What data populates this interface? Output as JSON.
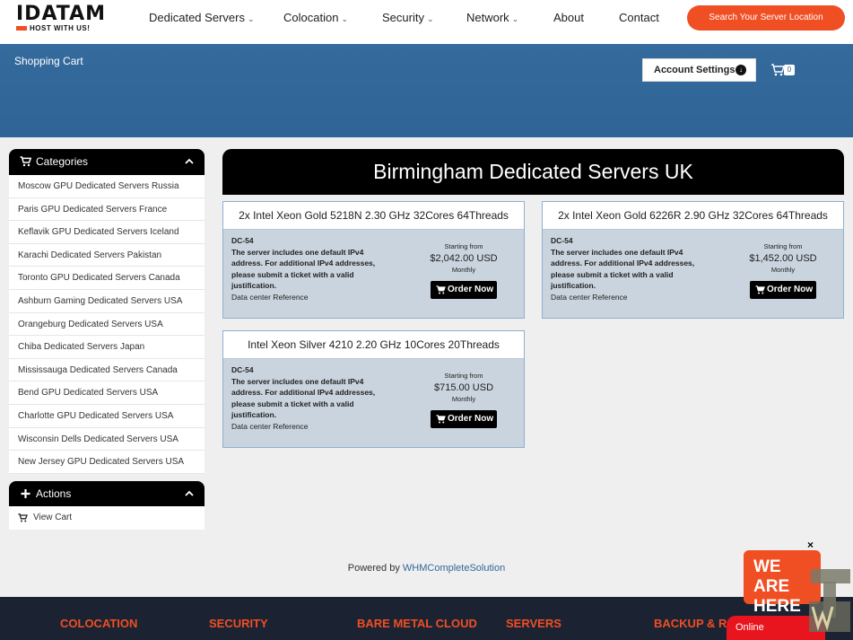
{
  "brand": {
    "name": "IDATAM",
    "tagline": "HOST WITH US!",
    "accent": "#f04e23"
  },
  "nav": {
    "items": [
      {
        "label": "Dedicated Servers",
        "dropdown": true
      },
      {
        "label": "Colocation",
        "dropdown": true
      },
      {
        "label": "Security",
        "dropdown": true
      },
      {
        "label": "Network",
        "dropdown": true
      },
      {
        "label": "About",
        "dropdown": false
      },
      {
        "label": "Contact",
        "dropdown": false
      }
    ],
    "search_button": "Search Your Server Location"
  },
  "header": {
    "title": "Shopping Cart",
    "account_button": "Account Settings",
    "cart_count": "0",
    "band_color": "#336699"
  },
  "sidebar": {
    "categories_title": "Categories",
    "categories": [
      "Moscow GPU Dedicated Servers Russia",
      "Paris GPU Dedicated Servers France",
      "Keflavik GPU Dedicated Servers Iceland",
      "Karachi Dedicated Servers Pakistan",
      "Toronto GPU Dedicated Servers Canada",
      "Ashburn Gaming Dedicated Servers USA",
      "Orangeburg Dedicated Servers USA",
      "Chiba Dedicated Servers Japan",
      "Mississauga Dedicated Servers Canada",
      "Bend GPU Dedicated Servers USA",
      "Charlotte GPU Dedicated Servers USA",
      "Wisconsin Dells Dedicated Servers USA",
      "New Jersey GPU Dedicated Servers USA"
    ],
    "actions_title": "Actions",
    "actions": [
      "View Cart"
    ]
  },
  "main": {
    "title": "Birmingham Dedicated Servers UK",
    "products": [
      {
        "name": "2x Intel Xeon Gold 5218N 2.30 GHz 32Cores 64Threads",
        "code": "DC-54",
        "description": "The server includes one default IPv4 address. For additional IPv4 addresses, please submit a ticket with a valid justification.",
        "reference": "Data center Reference",
        "starting_from": "Starting from",
        "price": "$2,042.00 USD",
        "cycle": "Monthly",
        "order_label": "Order Now"
      },
      {
        "name": "2x Intel Xeon Gold 6226R 2.90 GHz 32Cores 64Threads",
        "code": "DC-54",
        "description": "The server includes one default IPv4 address. For additional IPv4 addresses, please submit a ticket with a valid justification.",
        "reference": "Data center Reference",
        "starting_from": "Starting from",
        "price": "$1,452.00 USD",
        "cycle": "Monthly",
        "order_label": "Order Now"
      },
      {
        "name": "Intel Xeon Silver 4210 2.20 GHz 10Cores 20Threads",
        "code": "DC-54",
        "description": "The server includes one default IPv4 address. For additional IPv4 addresses, please submit a ticket with a valid justification.",
        "reference": "Data center Reference",
        "starting_from": "Starting from",
        "price": "$715.00 USD",
        "cycle": "Monthly",
        "order_label": "Order Now"
      }
    ]
  },
  "powered": {
    "prefix": "Powered by",
    "link": "WHMCompleteSolution"
  },
  "footer": {
    "columns": [
      "COLOCATION",
      "SECURITY",
      "BARE METAL CLOUD",
      "SERVERS",
      "BACKUP & R"
    ]
  },
  "chat": {
    "badge_line1": "WE ARE",
    "badge_line2": "HERE",
    "close": "×",
    "status": "Online"
  }
}
